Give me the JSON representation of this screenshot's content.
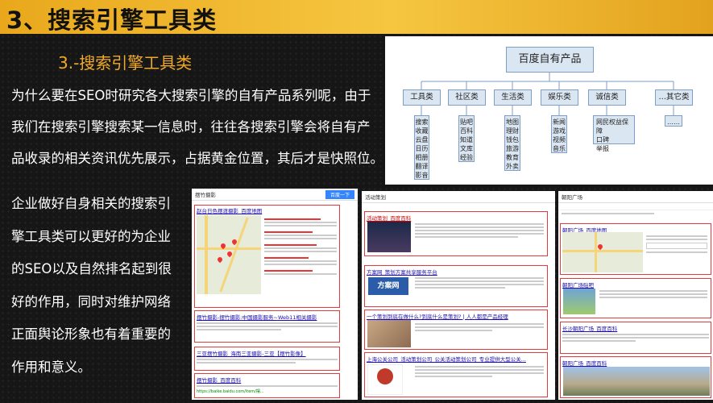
{
  "header": {
    "title": "3、搜索引擎工具类"
  },
  "subtitle": "3.-搜索引擎工具类",
  "para1": [
    "为什么要在SEO时研究各大搜索引擎的自有产品系列呢，由于",
    "我们在搜索引擎搜索某一信息时，往往各搜索引擎会将自有产",
    "品收录的相关资讯优先展示，占据黄金位置，其后才是快照位。"
  ],
  "para2": [
    "企业做好自身相关的搜索引",
    "擎工具类可以更好的为企业",
    "的SEO以及自然排名起到很",
    "好的作用，同时对维护网络",
    "正面舆论形象也有着重要的",
    "作用和意义。"
  ],
  "diagram": {
    "root": "百度自有产品",
    "categories": [
      {
        "label": "工具类",
        "items": [
          "搜索",
          "收藏",
          "云盘",
          "日历",
          "相册",
          "翻译",
          "影音"
        ]
      },
      {
        "label": "社区类",
        "items": [
          "贴吧",
          "百科",
          "知道",
          "文库",
          "经验"
        ]
      },
      {
        "label": "生活类",
        "items": [
          "地图",
          "理财",
          "钱包",
          "旅游",
          "教育",
          "外卖"
        ]
      },
      {
        "label": "娱乐类",
        "items": [
          "新闻",
          "游戏",
          "视频",
          "音乐"
        ]
      },
      {
        "label": "诚信类",
        "items": [
          "网民权益保障",
          "口碑",
          "举报"
        ]
      },
      {
        "label": "…其它类",
        "items": [
          "……"
        ]
      }
    ]
  },
  "shots": {
    "a": {
      "query": "摆竹摄影",
      "button": "百度一下",
      "results": [
        "赵台日色摆渡摄影_百度地图",
        "摆竹摄影-摆竹摄影:中国摄影服务~Web11相关摄影",
        "三亚摆竹摄影_海南三亚摄影-三亚【摆竹影像】",
        "摆竹摄影_百度百科"
      ],
      "url": "https://baike.baidu.com/item/摆..."
    },
    "b": {
      "query": "活动策划",
      "results": [
        "活动策划_百度百科",
        "方案网_策划方案共享服务平台",
        "一个策划到底在做什么?到底什么是策划? | 人人都是产品经理",
        "上海公关公司_活动策划公司_公关活动策划公司_专业提供大型公关..."
      ],
      "logo": "方案网"
    },
    "c": {
      "query": "朝阳广场",
      "results": [
        "朝阳广场_百度地图",
        "朝阳广场贴吧",
        "长沙朝阳广场_百度百科",
        "朝阳广场_百度百科"
      ]
    }
  }
}
